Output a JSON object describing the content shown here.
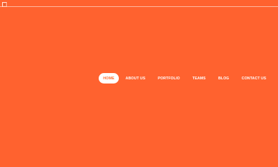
{
  "header": {
    "logo": {
      "icon": "broken-image-icon"
    }
  },
  "nav": {
    "items": [
      {
        "label": "HOME",
        "active": true
      },
      {
        "label": "ABOUT US",
        "active": false
      },
      {
        "label": "PORTFOLIO",
        "active": false
      },
      {
        "label": "TEAMS",
        "active": false
      },
      {
        "label": "BLOG",
        "active": false
      },
      {
        "label": "CONTACT US",
        "active": false
      }
    ]
  },
  "colors": {
    "background": "#ff622f",
    "accent_text": "#ffffff",
    "active_pill_text": "#ff6b2f",
    "active_pill_background": "#ffffff"
  }
}
